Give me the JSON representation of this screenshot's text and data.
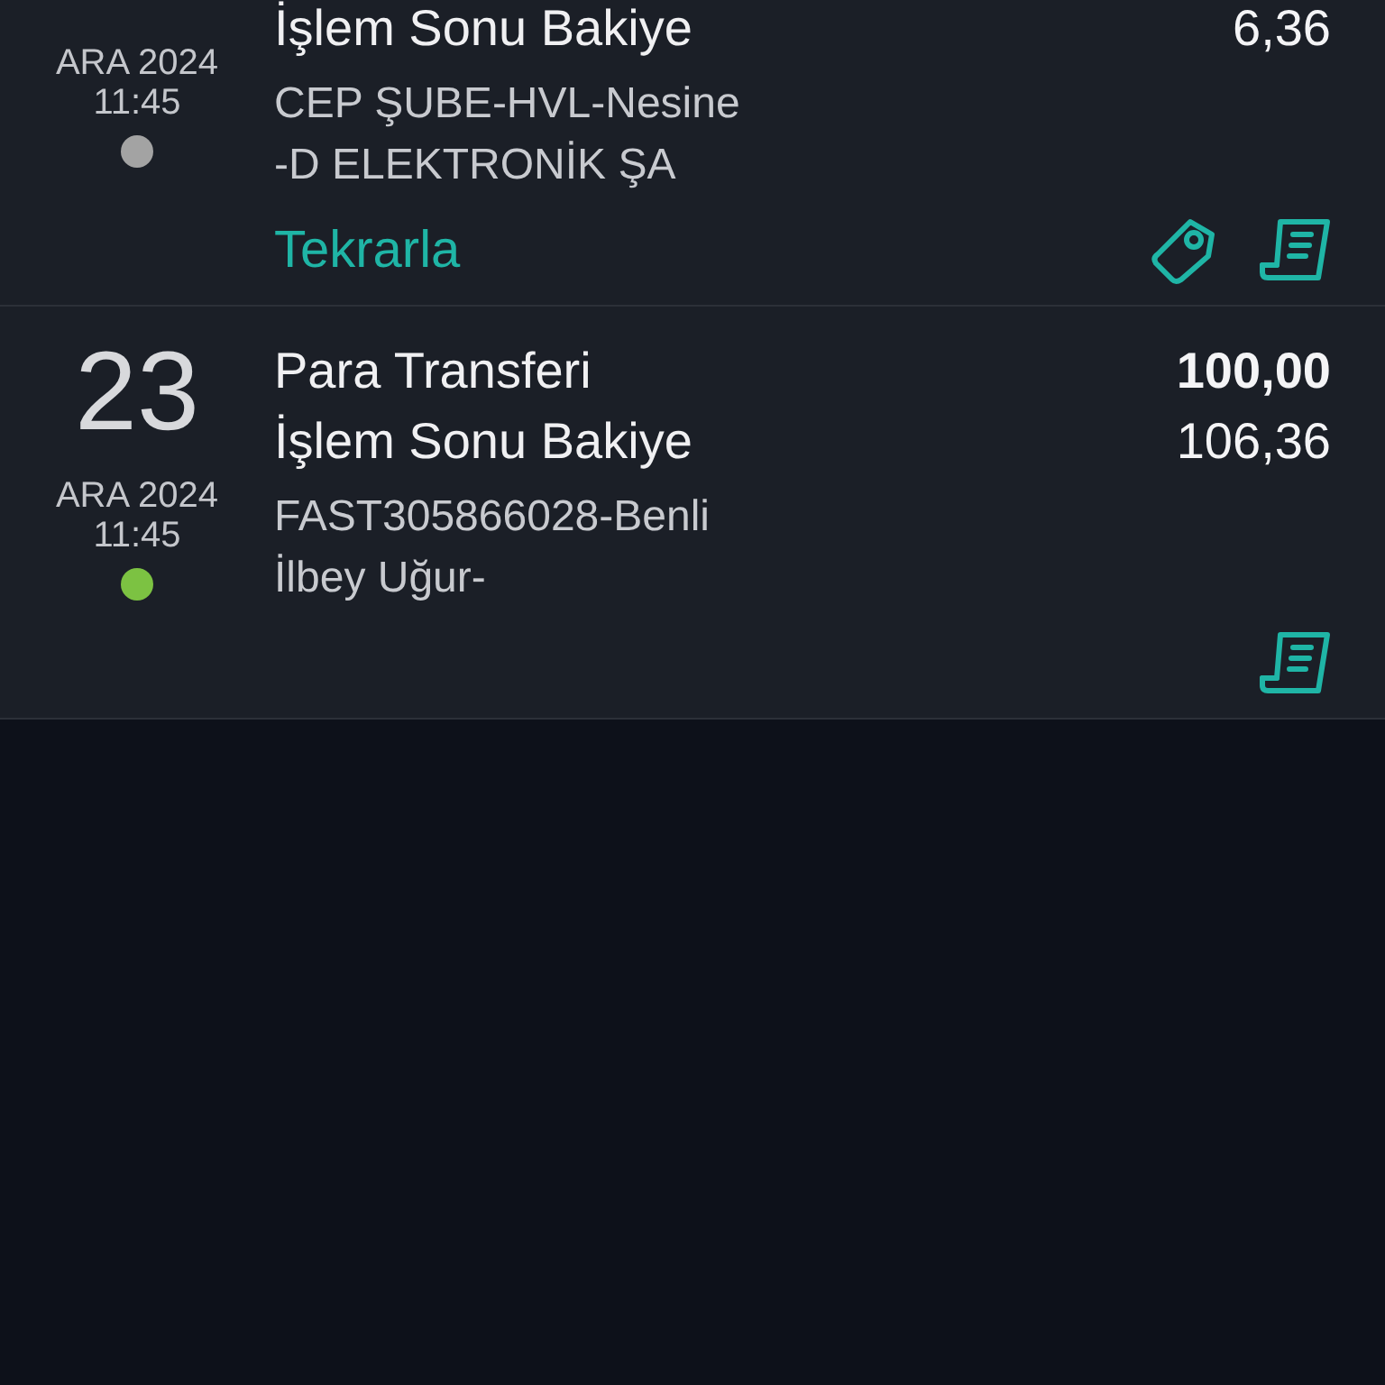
{
  "transactions": [
    {
      "month_year": "ARA 2024",
      "time": "11:45",
      "color": "#a3a3a3",
      "balance_label": "İşlem Sonu Bakiye",
      "balance": "6,36",
      "description": [
        "CEP ŞUBE-HVL-Nesine",
        "-D ELEKTRONİK ŞA"
      ],
      "repeat_label": "Tekrarla",
      "actions": [
        {
          "kind": "tag"
        },
        {
          "kind": "receipt"
        }
      ]
    },
    {
      "day": "23",
      "month_year": "ARA 2024",
      "time": "11:45",
      "color": "#7cc242",
      "title": "Para Transferi",
      "amount": "100,00",
      "balance_label": "İşlem Sonu Bakiye",
      "balance": "106,36",
      "description": [
        "FAST305866028-Benli",
        "İlbey Uğur-"
      ],
      "actions": [
        {
          "kind": "receipt"
        }
      ]
    }
  ]
}
